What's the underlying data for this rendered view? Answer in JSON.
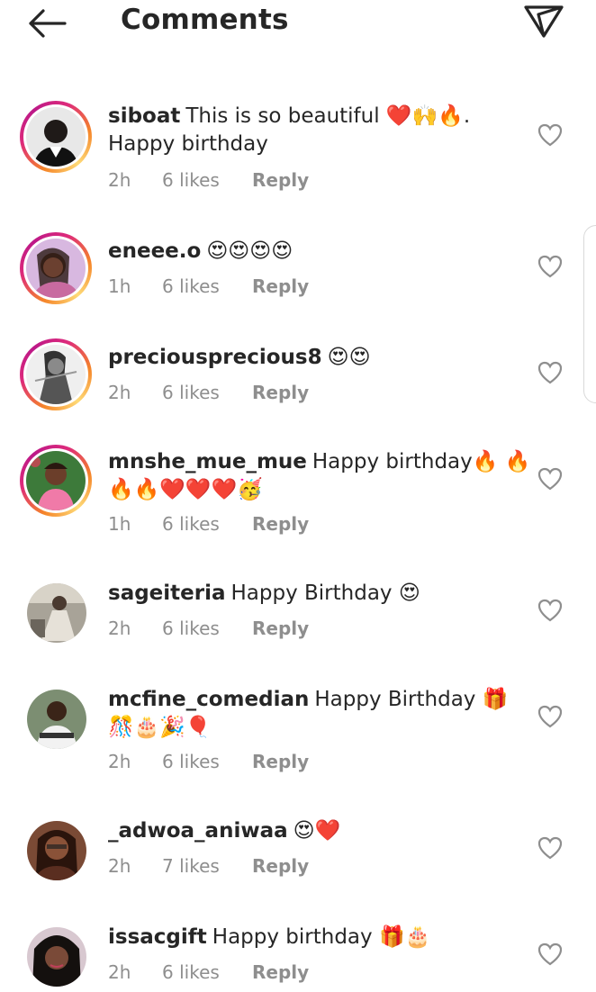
{
  "header": {
    "title": "Comments",
    "back_icon": "arrow-left-icon",
    "share_icon": "paper-plane-icon"
  },
  "comments": [
    {
      "username": "siboat",
      "text": "This is so beautiful ❤️🙌🔥. Happy birthday",
      "time": "2h",
      "likes": "6 likes",
      "reply": "Reply",
      "story_ring": true
    },
    {
      "username": "eneee.o",
      "text": "😍😍😍😍",
      "time": "1h",
      "likes": "6 likes",
      "reply": "Reply",
      "story_ring": true
    },
    {
      "username": "preciousprecious8",
      "text": "😍😍",
      "time": "2h",
      "likes": "6 likes",
      "reply": "Reply",
      "story_ring": true
    },
    {
      "username": "mnshe_mue_mue",
      "text": "Happy birthday🔥 🔥 🔥🔥❤️❤️❤️🥳",
      "time": "1h",
      "likes": "6 likes",
      "reply": "Reply",
      "story_ring": true
    },
    {
      "username": "sageiteria",
      "text": "Happy Birthday 😍",
      "time": "2h",
      "likes": "6 likes",
      "reply": "Reply",
      "story_ring": false
    },
    {
      "username": "mcfine_comedian",
      "text": "Happy Birthday 🎁 🎊🎂🎉🎈",
      "time": "2h",
      "likes": "6 likes",
      "reply": "Reply",
      "story_ring": false
    },
    {
      "username": "_adwoa_aniwaa",
      "text": "😍❤️",
      "time": "2h",
      "likes": "7 likes",
      "reply": "Reply",
      "story_ring": false
    },
    {
      "username": "issacgift",
      "text": "Happy birthday 🎁🎂",
      "time": "2h",
      "likes": "6 likes",
      "reply": "Reply",
      "story_ring": false
    }
  ],
  "colors": {
    "text": "#262626",
    "secondary": "#8e8e8e",
    "story_ring_start": "#f58529",
    "story_ring_end": "#dd2a7b"
  }
}
